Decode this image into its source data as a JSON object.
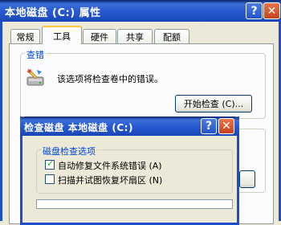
{
  "main_window": {
    "title": "本地磁盘 (C:) 属性",
    "help_label": "?",
    "close_label": "✕"
  },
  "tabs": [
    {
      "label": "常规"
    },
    {
      "label": "工具"
    },
    {
      "label": "硬件"
    },
    {
      "label": "共享"
    },
    {
      "label": "配额"
    }
  ],
  "error_check": {
    "group_title": "查错",
    "description": "该选项将检查卷中的错误。",
    "button_label": "开始检查 (C)..."
  },
  "dialog": {
    "title": "检查磁盘 本地磁盘 (C:)",
    "help_label": "?",
    "close_label": "✕",
    "options_title": "磁盘检查选项",
    "option1_label": "自动修复文件系统错误 (A)",
    "option1_checked": "✓",
    "option2_label": "扫描并试图恢复坏扇区 (N)"
  }
}
